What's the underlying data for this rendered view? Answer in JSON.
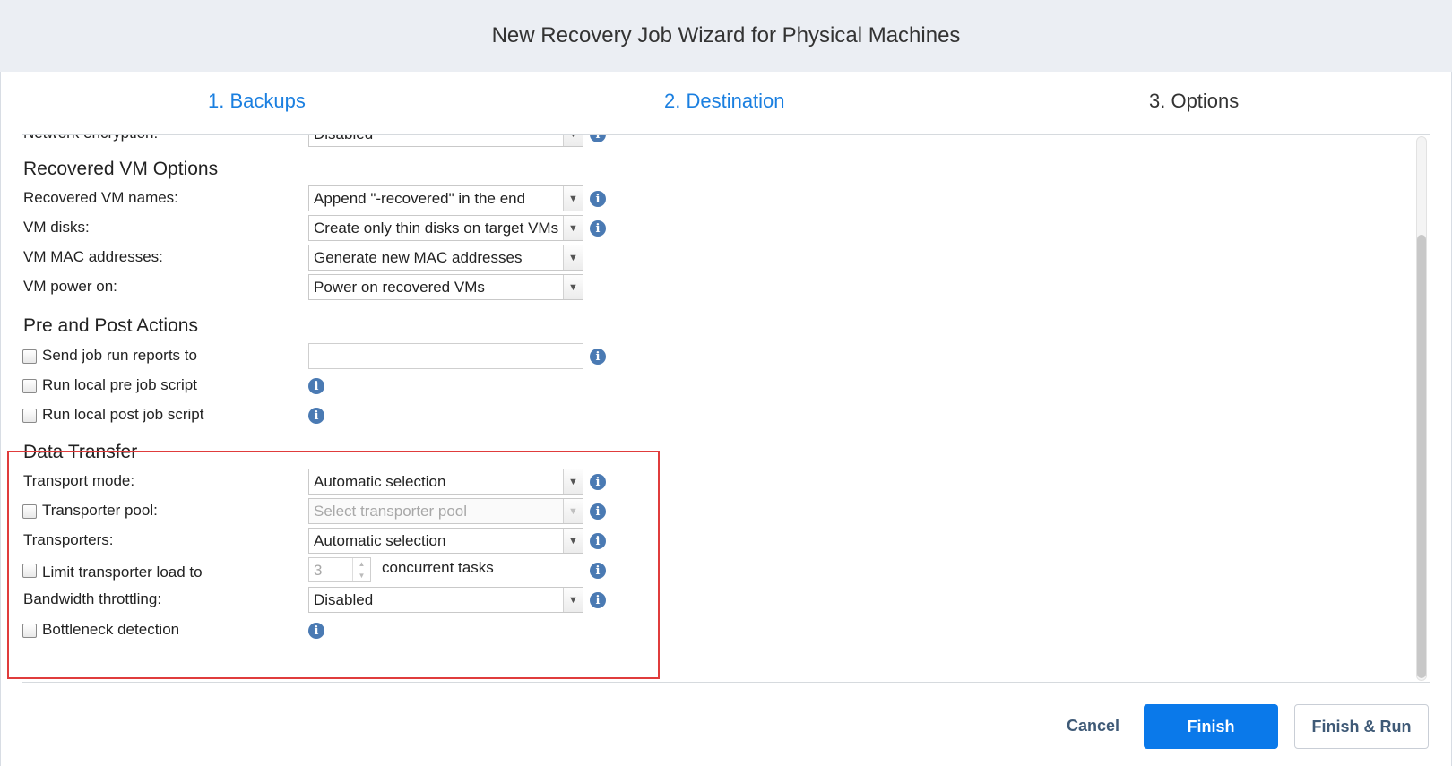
{
  "window": {
    "title": "New Recovery Job Wizard for Physical Machines"
  },
  "steps": [
    {
      "label": "1. Backups",
      "state": "link"
    },
    {
      "label": "2. Destination",
      "state": "link"
    },
    {
      "label": "3. Options",
      "state": "current"
    }
  ],
  "cut_off_row": {
    "label": "Network encryption:",
    "value": "Disabled"
  },
  "recovered_vm_options": {
    "title": "Recovered VM Options",
    "names": {
      "label": "Recovered VM names:",
      "value": "Append \"-recovered\" in the end"
    },
    "disks": {
      "label": "VM disks:",
      "value": "Create only thin disks on target VMs"
    },
    "mac": {
      "label": "VM MAC addresses:",
      "value": "Generate new MAC addresses"
    },
    "power": {
      "label": "VM power on:",
      "value": "Power on recovered VMs"
    }
  },
  "pre_post_actions": {
    "title": "Pre and Post Actions",
    "send_reports": {
      "label": "Send job run reports to",
      "checked": false,
      "value": ""
    },
    "pre_script": {
      "label": "Run local pre job script",
      "checked": false
    },
    "post_script": {
      "label": "Run local post job script",
      "checked": false
    }
  },
  "data_transfer": {
    "title": "Data Transfer",
    "transport_mode": {
      "label": "Transport mode:",
      "value": "Automatic selection"
    },
    "transporter_pool": {
      "label": "Transporter pool:",
      "checked": false,
      "placeholder": "Select transporter pool"
    },
    "transporters": {
      "label": "Transporters:",
      "value": "Automatic selection"
    },
    "limit_load": {
      "label": "Limit transporter load to",
      "checked": false,
      "value": "3",
      "suffix": "concurrent tasks"
    },
    "bandwidth": {
      "label": "Bandwidth throttling:",
      "value": "Disabled"
    },
    "bottleneck": {
      "label": "Bottleneck detection",
      "checked": false
    }
  },
  "icons": {
    "info": "i",
    "dropdown": "▼",
    "spin_up": "▲",
    "spin_down": "▼"
  },
  "buttons": {
    "cancel": "Cancel",
    "finish": "Finish",
    "finish_run": "Finish & Run"
  },
  "colors": {
    "accent": "#0a79ea",
    "link": "#1a7fe0",
    "highlight": "#e03c3c",
    "info": "#4a7ab3"
  }
}
